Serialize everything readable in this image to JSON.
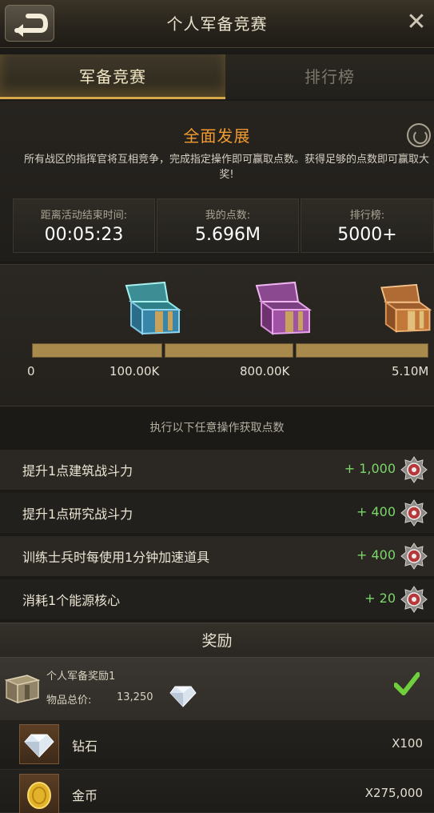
{
  "header": {
    "title": "个人军备竞赛",
    "close_symbol": "✕"
  },
  "tabs": [
    {
      "label": "军备竞赛",
      "active": true
    },
    {
      "label": "排行榜",
      "active": false
    }
  ],
  "event": {
    "title": "全面发展",
    "description": "所有战区的指挥官将互相竞争，完成指定操作即可赢取点数。获得足够的点数即可赢取大奖!"
  },
  "stats": [
    {
      "label": "距离活动结束时间:",
      "value": "00:05:23"
    },
    {
      "label": "我的点数:",
      "value": "5.696M"
    },
    {
      "label": "排行榜:",
      "value": "5000+"
    }
  ],
  "progress": {
    "current_points_label": "5.696M",
    "milestones": [
      {
        "label": "0",
        "chest": "none"
      },
      {
        "label": "100.00K",
        "chest": "blue-chest"
      },
      {
        "label": "800.00K",
        "chest": "purple-chest"
      },
      {
        "label": "5.10M",
        "chest": "orange-chest"
      }
    ],
    "bar_fill_fraction": 1.0,
    "bar_color": "#a98a4d"
  },
  "tasks_header": "执行以下任意操作获取点数",
  "tasks": [
    {
      "name": "提升1点建筑战斗力",
      "points": "+ 1,000"
    },
    {
      "name": "提升1点研究战斗力",
      "points": "+ 400"
    },
    {
      "name": "训练士兵时每使用1分钟加速道具",
      "points": "+ 400"
    },
    {
      "name": "消耗1个能源核心",
      "points": "+ 20"
    }
  ],
  "reward": {
    "title": "奖励",
    "pack": {
      "name": "个人军备奖励1",
      "price_label": "物品总价:",
      "price_value": "13,250",
      "claimed": true
    },
    "items": [
      {
        "name": "钻石",
        "qty": "X100",
        "icon": "diamond-icon"
      },
      {
        "name": "金币",
        "qty": "X275,000",
        "icon": "gold-coin-icon"
      }
    ]
  },
  "colors": {
    "accent_orange": "#f09a32",
    "points_green": "#7bd66a",
    "tab_underline": "#d7a848"
  }
}
